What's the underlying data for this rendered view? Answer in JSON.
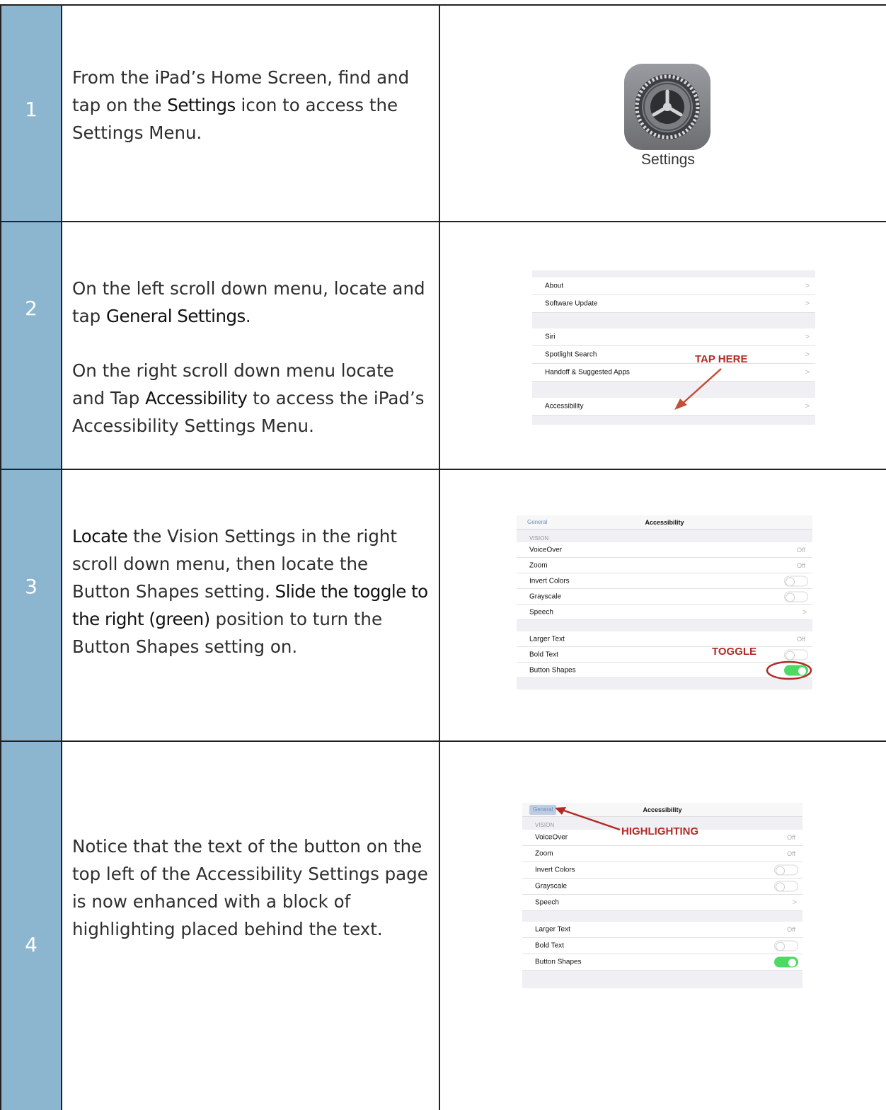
{
  "steps": [
    {
      "number": "1",
      "text_parts": {
        "p1": "From the iPad’s Home Screen, find and tap on the ",
        "p1_hl": "Settings",
        "p1_end": " icon to access the Settings Menu."
      },
      "image": {
        "icon_label": "Settings"
      }
    },
    {
      "number": "2",
      "text_parts": {
        "p1": "On the left scroll down menu, locate and tap ",
        "p1_hl": "General Settings",
        "p1_end": ".",
        "p2": "On the right scroll down menu locate and Tap ",
        "p2_hl": "Accessibility",
        "p2_end": " to access the iPad’s Accessibility Settings Menu."
      },
      "image": {
        "items": [
          "About",
          "Software Update",
          "Siri",
          "Spotlight Search",
          "Handoff & Suggested Apps",
          "Accessibility"
        ],
        "callout": "TAP HERE"
      }
    },
    {
      "number": "3",
      "text_parts": {
        "p1_hl": "Locate",
        "p1": " the Vision Settings in the right scroll down menu, then locate the Button Shapes setting",
        "p1_hl2": ". Slide the toggle to the right (green)",
        "p1_end": " position to turn the Button Shapes setting on."
      },
      "image": {
        "back": "General",
        "title": "Accessibility",
        "section": "VISION",
        "items": [
          "VoiceOver",
          "Zoom",
          "Invert Colors",
          "Grayscale",
          "Speech",
          "Larger Text",
          "Bold Text",
          "Button Shapes"
        ],
        "off": "Off",
        "callout": "TOGGLE"
      }
    },
    {
      "number": "4",
      "text_parts": {
        "p1": "Notice that the text of the button on the top left of the Accessibility Settings page is now enhanced with a block of highlighting placed behind the text."
      },
      "image": {
        "back": "General",
        "title": "Accessibility",
        "section": "VISION",
        "items": [
          "VoiceOver",
          "Zoom",
          "Invert Colors",
          "Grayscale",
          "Speech",
          "Larger Text",
          "Bold Text",
          "Button Shapes"
        ],
        "off": "Off",
        "callout": "HIGHLIGHTING"
      }
    }
  ],
  "colors": {
    "number_column": "#8cb5cf",
    "callout": "#b12a26",
    "toggle_on": "#4cd964"
  }
}
